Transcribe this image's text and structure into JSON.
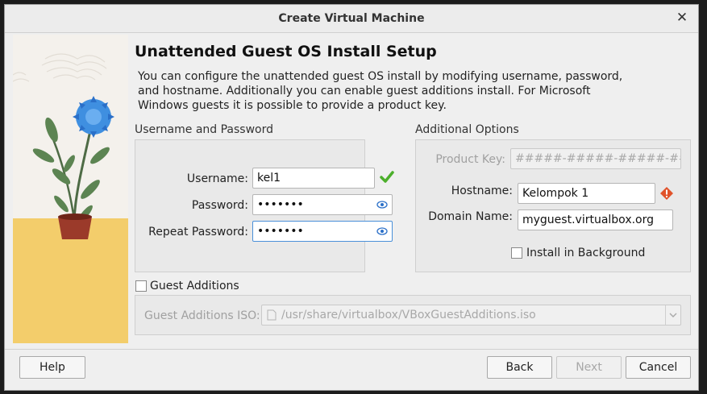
{
  "window": {
    "title": "Create Virtual Machine"
  },
  "page": {
    "title": "Unattended Guest OS Install Setup",
    "description": "You can configure the unattended guest OS install by modifying username, password, and hostname. Additionally you can enable guest additions install. For Microsoft Windows guests it is possible to provide a product key."
  },
  "credentials": {
    "group_title": "Username and Password",
    "username_label": "Username:",
    "username_value": "kel1",
    "password_label": "Password:",
    "password_value": "•••••••",
    "repeat_label": "Repeat Password:",
    "repeat_value": "•••••••"
  },
  "additional": {
    "group_title": "Additional Options",
    "product_key_label": "Product Key:",
    "product_key_placeholder": "#####-#####-#####-####",
    "hostname_label": "Hostname:",
    "hostname_value": "Kelompok 1",
    "domain_label": "Domain Name:",
    "domain_value": "myguest.virtualbox.org",
    "install_bg_label": "Install in Background"
  },
  "guest_additions": {
    "checkbox_label": "Guest Additions",
    "iso_label": "Guest Additions ISO:",
    "iso_path": "/usr/share/virtualbox/VBoxGuestAdditions.iso"
  },
  "buttons": {
    "help": "Help",
    "back": "Back",
    "next": "Next",
    "cancel": "Cancel"
  },
  "colors": {
    "valid": "#4caf2c",
    "warning": "#e0522a",
    "focus": "#4a90d9"
  }
}
